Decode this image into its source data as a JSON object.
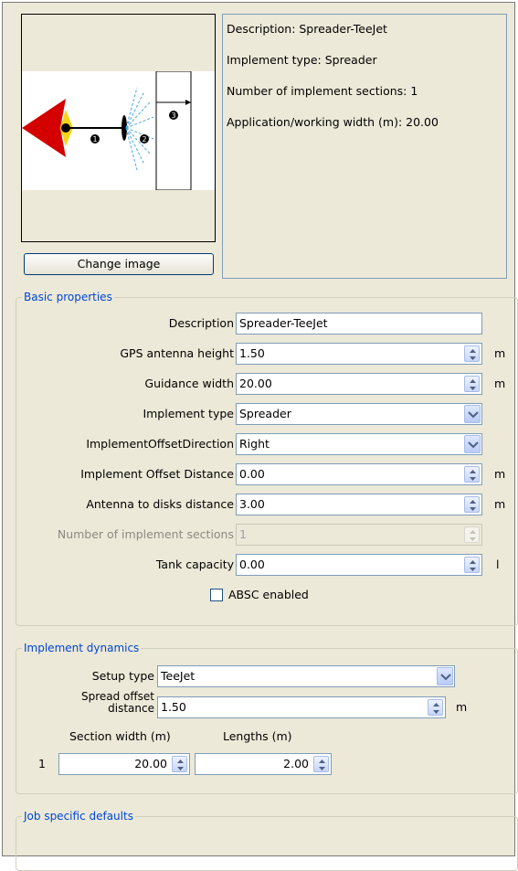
{
  "preview": {
    "change_image_label": "Change image",
    "info": {
      "description": "Description: Spreader-TeeJet",
      "implement_type": "Implement type: Spreader",
      "sections": "Number of implement sections: 1",
      "width": "Application/working width (m): 20.00"
    },
    "diagram_labels": [
      "1",
      "2",
      "3"
    ]
  },
  "basic_properties": {
    "title": "Basic properties",
    "fields": [
      {
        "label": "Description",
        "value": "Spreader-TeeJet",
        "kind": "text",
        "unit": ""
      },
      {
        "label": "GPS antenna height",
        "value": "1.50",
        "kind": "spin",
        "unit": "m"
      },
      {
        "label": "Guidance width",
        "value": "20.00",
        "kind": "spin",
        "unit": "m"
      },
      {
        "label": "Implement type",
        "value": "Spreader",
        "kind": "dropdown",
        "unit": ""
      },
      {
        "label": "ImplementOffsetDirection",
        "value": "Right",
        "kind": "dropdown",
        "unit": ""
      },
      {
        "label": "Implement Offset Distance",
        "value": "0.00",
        "kind": "spin",
        "unit": "m"
      },
      {
        "label": "Antenna to disks distance",
        "value": "3.00",
        "kind": "spin",
        "unit": "m"
      },
      {
        "label": "Number of implement sections",
        "value": "1",
        "kind": "spin-disabled",
        "unit": ""
      },
      {
        "label": "Tank capacity",
        "value": "0.00",
        "kind": "spin",
        "unit": "l"
      }
    ],
    "absc_label": "ABSC enabled",
    "absc_checked": false
  },
  "implement_dynamics": {
    "title": "Implement dynamics",
    "setup_type_label": "Setup type",
    "setup_type_value": "TeeJet",
    "spread_offset_label_1": "Spread offset",
    "spread_offset_label_2": "distance",
    "spread_offset_value": "1.50",
    "spread_offset_unit": "m",
    "section_width_header": "Section width (m)",
    "lengths_header": "Lengths (m)",
    "rows": [
      {
        "index": "1",
        "width": "20.00",
        "length": "2.00"
      }
    ]
  },
  "job_defaults": {
    "title": "Job specific defaults"
  },
  "colors": {
    "panel": "#ece9d8",
    "legend_text": "#0046d5",
    "field_border": "#7f9db9"
  }
}
